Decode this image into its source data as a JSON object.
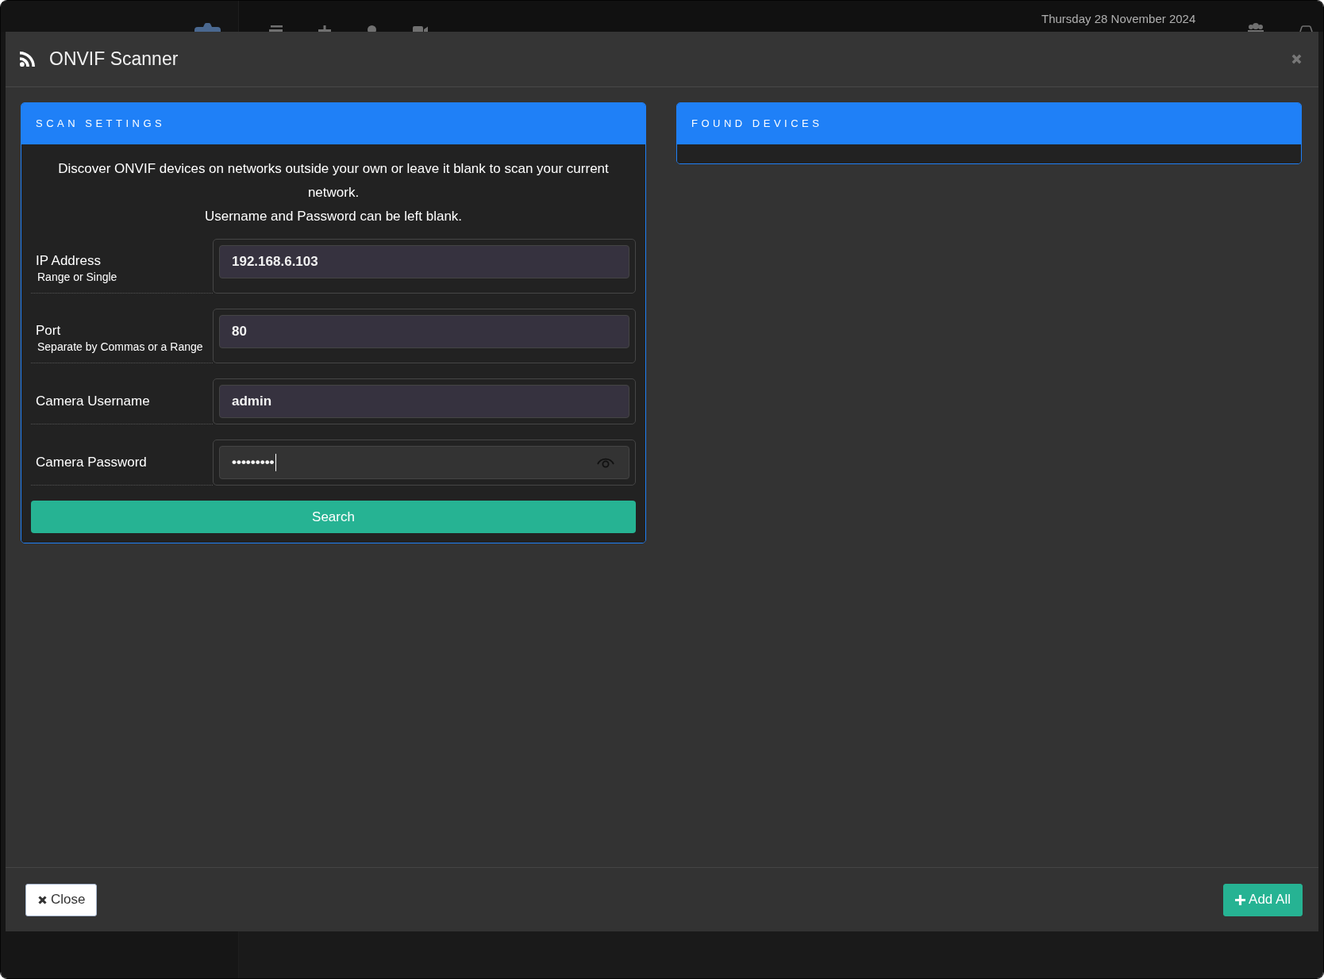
{
  "top_bar": {
    "date": "Thursday 28 November 2024"
  },
  "dialog": {
    "title": "ONVIF Scanner",
    "panels": [
      {
        "kind": "form",
        "title": "SCAN SETTINGS",
        "description": [
          "Discover ONVIF devices on networks outside your own or leave it blank to scan your current network.",
          "Username and Password can be left blank."
        ],
        "fields": [
          {
            "label": "IP Address",
            "hint": "Range or Single",
            "value": "192.168.6.103",
            "kind": "text",
            "focused": false
          },
          {
            "label": "Port",
            "hint": "Separate by Commas or a Range",
            "value": "80",
            "kind": "text",
            "focused": false
          },
          {
            "label": "Camera Username",
            "value": "admin",
            "kind": "text",
            "focused": false
          },
          {
            "label": "Camera Password",
            "value": "•••••••••",
            "kind": "password",
            "focused": true
          }
        ],
        "submit": "Search"
      },
      {
        "kind": "list",
        "title": "FOUND DEVICES"
      }
    ],
    "footer_buttons": [
      {
        "label": "Close",
        "kind": "close"
      },
      {
        "label": "Add All",
        "kind": "add"
      }
    ]
  }
}
